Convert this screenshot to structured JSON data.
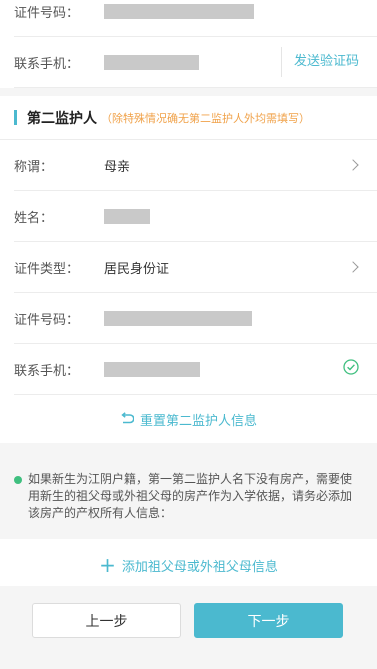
{
  "guardian1": {
    "id_label": "证件号码：",
    "phone_label": "联系手机：",
    "send_code": "发送验证码"
  },
  "guardian2": {
    "section_title": "第二监护人",
    "section_hint": "（除特殊情况确无第二监护人外均需填写）",
    "relation_label": "称谓：",
    "relation_value": "母亲",
    "name_label": "姓名：",
    "id_type_label": "证件类型：",
    "id_type_value": "居民身份证",
    "id_label": "证件号码：",
    "phone_label": "联系手机：",
    "reset_label": "重置第二监护人信息"
  },
  "notice": {
    "text": "如果新生为江阴户籍，第一第二监护人名下没有房产，需要使用新生的祖父母或外祖父母的房产作为入学依据，请务必添加该房产的产权所有人信息："
  },
  "add_grandparent": {
    "label": "添加祖父母或外祖父母信息"
  },
  "footer": {
    "prev_label": "上一步",
    "next_label": "下一步"
  },
  "colors": {
    "accent": "#4bb9cf",
    "hint": "#f0a24a",
    "success": "#3fbf7f"
  },
  "icons": [
    "chevron-right-icon",
    "reset-icon",
    "check-circle-icon",
    "plus-icon",
    "bullet-dot-icon"
  ]
}
